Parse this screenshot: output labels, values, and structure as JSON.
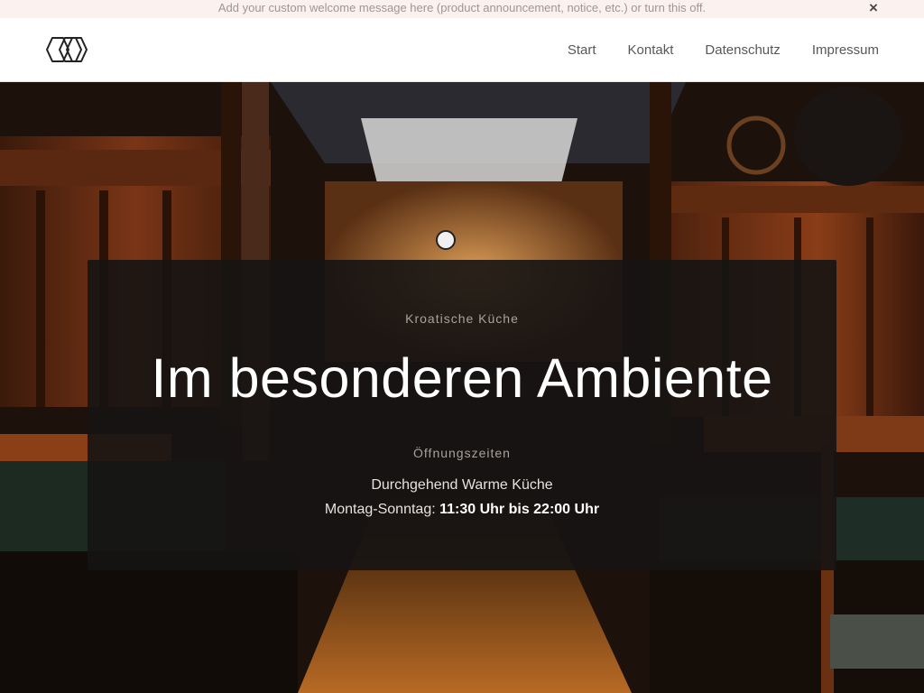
{
  "announcement": {
    "text": "Add your custom welcome message here (product announcement, notice, etc.) or turn this off.",
    "close_glyph": "×"
  },
  "header": {
    "logo_icon": "hexagon-logo-icon",
    "nav": [
      {
        "label": "Start"
      },
      {
        "label": "Kontakt"
      },
      {
        "label": "Datenschutz"
      },
      {
        "label": "Impressum"
      }
    ]
  },
  "hero": {
    "kicker": "Kroatische Küche",
    "headline": "Im besonderen Ambiente",
    "hours_label": "Öffnungszeiten",
    "line1": "Durchgehend Warme Küche",
    "line2_prefix": "Montag-Sonntag: ",
    "line2_bold": "11:30 Uhr bis 22:00 Uhr"
  },
  "colors": {
    "announcement_bg": "#fbf2ef",
    "panel_bg": "#161413",
    "wood": "#6b2f14"
  }
}
